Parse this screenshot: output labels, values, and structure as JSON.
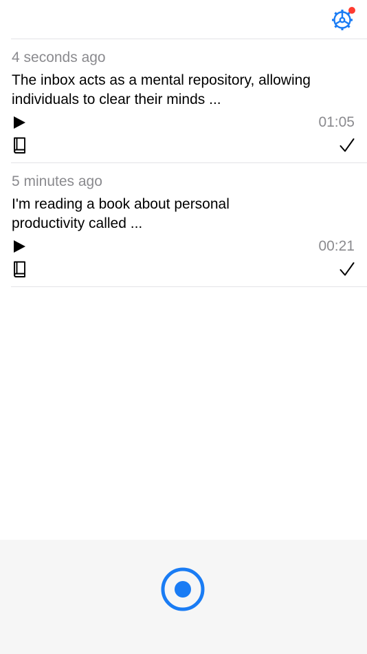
{
  "header": {
    "settings_icon": "gear-icon",
    "notification_color": "#ff3b30",
    "accent_color": "#1a7cf4"
  },
  "items": [
    {
      "time_ago": "4 seconds ago",
      "text": "The inbox acts as a mental repository, allowing individuals to clear their minds ...",
      "duration": "01:05",
      "play_icon": "play-icon",
      "book_icon": "book-icon",
      "check_icon": "checkmark-icon"
    },
    {
      "time_ago": "5 minutes ago",
      "text": "I'm reading a book about personal productivity called ...",
      "duration": "00:21",
      "play_icon": "play-icon",
      "book_icon": "book-icon",
      "check_icon": "checkmark-icon"
    }
  ],
  "footer": {
    "record_icon": "record-icon",
    "record_color": "#1a7cf4"
  }
}
